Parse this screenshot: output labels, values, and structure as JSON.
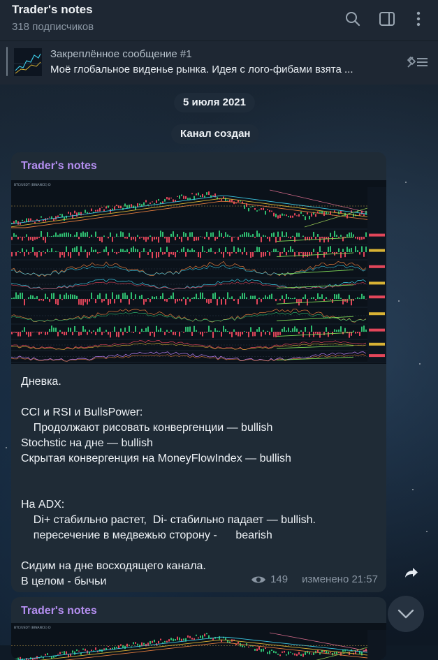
{
  "header": {
    "title": "Trader's notes",
    "subtitle": "318 подписчиков",
    "icons": [
      "search-icon",
      "sidebar-toggle-icon",
      "more-vertical-icon"
    ]
  },
  "pinned": {
    "title": "Закреплённое сообщение #1",
    "text": "Моё глобальное виденье рынка. Идея с лого-фибами взята ...",
    "icon": "unpin-list-icon"
  },
  "service": {
    "date": "5 июля 2021",
    "created": "Канал создан"
  },
  "message1": {
    "author": "Trader's notes",
    "chart_header": "BTC/USDT (BINANCE) D",
    "lines": [
      "Дневка.",
      "",
      "CCI и RSI и BullsPower:",
      "    Продолжают рисовать конвергенции — bullish",
      "Stochstic на дне — bullish",
      "Скрытая конвергенция на MoneyFlowIndex — bullish",
      "",
      "",
      "На ADX:",
      "    Di+ стабильно растет,  Di- стабильно падает — bullish.",
      "    пересечение в медвежью сторону -      bearish",
      "",
      "Сидим на дне восходящего канала.",
      "В целом - бычьи"
    ],
    "views": "149",
    "edited": "изменено 21:57"
  },
  "message2": {
    "author": "Trader's notes"
  },
  "colors": {
    "author": "#b48ef0",
    "bubble": "#1f2b36",
    "header": "#1e2733",
    "meta": "#8a96a3"
  }
}
